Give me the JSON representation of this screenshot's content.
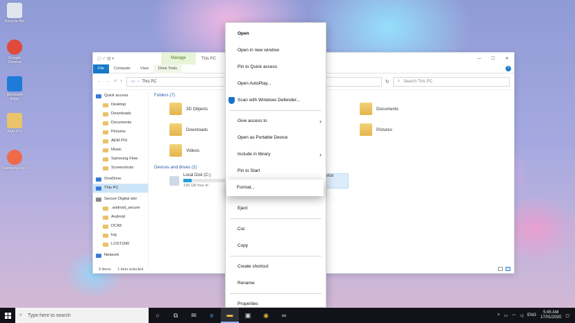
{
  "desktop": {
    "icons": [
      {
        "label": "Recycle Bin",
        "icon": "recycle-bin-icon",
        "color": "#dfe6ee"
      },
      {
        "label": "Google Chrome",
        "icon": "chrome-icon",
        "color": "#e04a3a"
      },
      {
        "label": "Microsoft Edge",
        "icon": "edge-icon",
        "color": "#1e7bd8"
      },
      {
        "label": "AEM PIX",
        "icon": "folder-icon",
        "color": "#e9c46a"
      },
      {
        "label": "Samsung DeX",
        "icon": "dex-icon",
        "color": "#ef6a4a"
      }
    ]
  },
  "explorer": {
    "title": "This PC",
    "manage_tab": "Manage",
    "tabs": [
      "File",
      "Computer",
      "View",
      "Drive Tools"
    ],
    "address": "This PC",
    "search_placeholder": "Search This PC",
    "nav": [
      {
        "label": "Quick access"
      },
      {
        "label": "Desktop"
      },
      {
        "label": "Downloads"
      },
      {
        "label": "Documents"
      },
      {
        "label": "Pictures"
      },
      {
        "label": "AEM PIX"
      },
      {
        "label": "Music"
      },
      {
        "label": "Samsung Flow"
      },
      {
        "label": "Screenshots"
      },
      {
        "label": "OneDrive"
      },
      {
        "label": "This PC"
      },
      {
        "label": "Secure Digital stor"
      },
      {
        "label": ".android_secure"
      },
      {
        "label": "Android"
      },
      {
        "label": "DCIM"
      },
      {
        "label": "log"
      },
      {
        "label": "LOST.DIR"
      },
      {
        "label": "Network"
      }
    ],
    "folders_header": "Folders (7)",
    "folders": [
      "3D Objects",
      "Downloads",
      "Videos",
      "Documents",
      "Pictures"
    ],
    "devices_header": "Devices and drives (2)",
    "drive": {
      "name": "Local Disk (C:)",
      "free": "199 GB free of",
      "used_fraction": 0.2
    },
    "drive2_label": "device",
    "status": {
      "items": "9 items",
      "selected": "1 item selected"
    }
  },
  "context_menu": {
    "items": [
      {
        "label": "Open",
        "bold": true
      },
      {
        "label": "Open in new window"
      },
      {
        "label": "Pin to Quick access"
      },
      {
        "label": "Open AutoPlay..."
      },
      {
        "label": "Scan with Windows Defender...",
        "icon": "shield"
      },
      {
        "sep": true
      },
      {
        "label": "Give access to",
        "arrow": true
      },
      {
        "label": "Open as Portable Device"
      },
      {
        "label": "Include in library",
        "arrow": true
      },
      {
        "label": "Pin to Start"
      },
      {
        "sep": true
      },
      {
        "label": "Format..."
      },
      {
        "label": "Eject"
      },
      {
        "sep": true
      },
      {
        "label": "Cut"
      },
      {
        "label": "Copy"
      },
      {
        "sep": true
      },
      {
        "label": "Create shortcut"
      },
      {
        "label": "Rename"
      },
      {
        "sep": true
      },
      {
        "label": "Properties"
      }
    ]
  },
  "taskbar": {
    "search_placeholder": "Type here to search",
    "language": "ENG",
    "time": "5:45 AM",
    "date": "17/01/2020"
  }
}
